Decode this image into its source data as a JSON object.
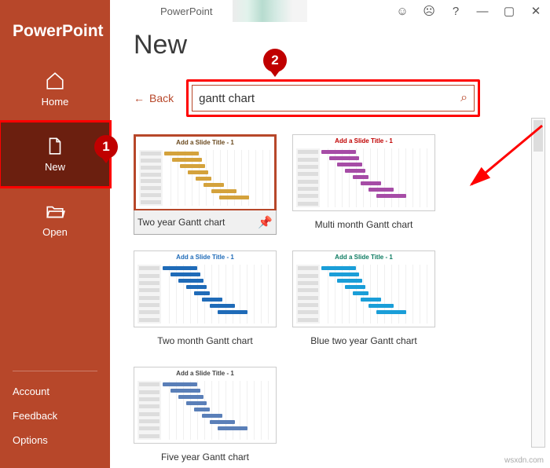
{
  "app_title": "PowerPoint",
  "titlebar_title": "PowerPoint",
  "page_title": "New",
  "back_label": "Back",
  "search_value": "gantt chart",
  "sidebar": {
    "items": [
      {
        "label": "Home"
      },
      {
        "label": "New"
      },
      {
        "label": "Open"
      }
    ],
    "bottom": [
      {
        "label": "Account"
      },
      {
        "label": "Feedback"
      },
      {
        "label": "Options"
      }
    ]
  },
  "templates": [
    {
      "caption": "Two year Gantt chart",
      "thumb_title": "Add a Slide Title - 1",
      "thumb_title_color": "#6b4a1f",
      "bar_color": "#d4a23c",
      "selected": true
    },
    {
      "caption": "Multi month Gantt chart",
      "thumb_title": "Add a Slide Title - 1",
      "thumb_title_color": "#c00000",
      "bar_color": "#a64ca6"
    },
    {
      "caption": "Two month Gantt chart",
      "thumb_title": "Add a Slide Title - 1",
      "thumb_title_color": "#1f6bb8",
      "bar_color": "#1f6bb8"
    },
    {
      "caption": "Blue two year Gantt chart",
      "thumb_title": "Add a Slide Title - 1",
      "thumb_title_color": "#0e7c62",
      "bar_color": "#1a9ed8"
    },
    {
      "caption": "Five year Gantt chart",
      "thumb_title": "Add a Slide Title - 1",
      "thumb_title_color": "#444444",
      "bar_color": "#5a7fb8"
    }
  ],
  "callouts": {
    "c1": "1",
    "c2": "2"
  },
  "watermark": "wsxdn.com"
}
